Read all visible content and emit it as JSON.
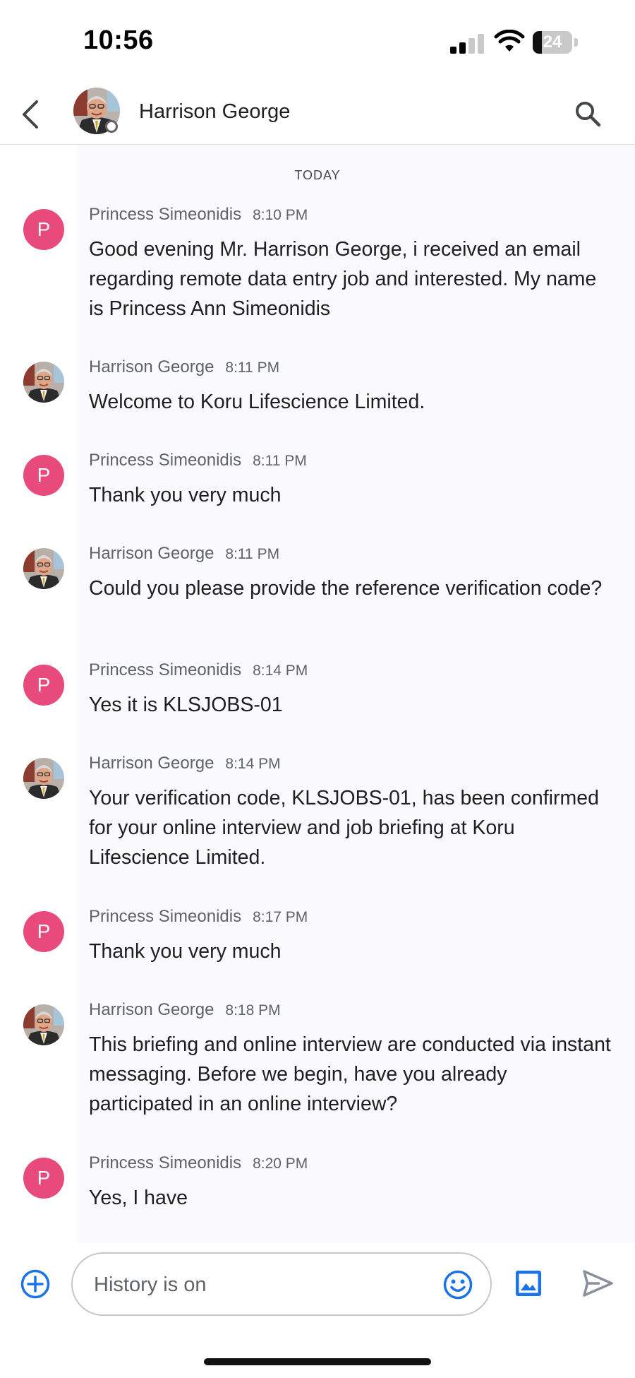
{
  "status_bar": {
    "time": "10:56",
    "battery": "24",
    "battery_level": 0.24,
    "signal_bars": 2
  },
  "header": {
    "title": "Harrison George",
    "back_icon": "chevron-left-icon",
    "search_icon": "search-icon",
    "avatar": "harrison-george-photo"
  },
  "chat": {
    "date_separator": "TODAY",
    "messages": [
      {
        "sender": "Princess Simeonidis",
        "time": "8:10 PM",
        "avatar_letter": "P",
        "text": "Good evening Mr. Harrison George, i received an email regarding remote data entry job and interested. My name is Princess Ann Simeonidis"
      },
      {
        "sender": "Harrison George",
        "time": "8:11 PM",
        "avatar_letter": "",
        "text": "Welcome to Koru Lifescience Limited."
      },
      {
        "sender": "Princess Simeonidis",
        "time": "8:11 PM",
        "avatar_letter": "P",
        "text": "Thank you very much"
      },
      {
        "sender": "Harrison George",
        "time": "8:11 PM",
        "avatar_letter": "",
        "text": "Could you please provide the reference verification code?"
      },
      {
        "sender": "Princess Simeonidis",
        "time": "8:14 PM",
        "avatar_letter": "P",
        "text": "Yes it is KLSJOBS-01"
      },
      {
        "sender": "Harrison George",
        "time": "8:14 PM",
        "avatar_letter": "",
        "text": "Your verification code, KLSJOBS-01, has been confirmed for your online interview and job briefing at Koru Lifescience Limited."
      },
      {
        "sender": "Princess Simeonidis",
        "time": "8:17 PM",
        "avatar_letter": "P",
        "text": "Thank you very much"
      },
      {
        "sender": "Harrison George",
        "time": "8:18 PM",
        "avatar_letter": "",
        "text": "This briefing and online interview are conducted via instant messaging. Before we begin, have you already participated in an online interview?"
      },
      {
        "sender": "Princess Simeonidis",
        "time": "8:20 PM",
        "avatar_letter": "P",
        "text": "Yes, I have"
      }
    ]
  },
  "composer": {
    "placeholder": "History is on",
    "add_icon": "add-circle-icon",
    "emoji_icon": "emoji-icon",
    "image_icon": "image-icon",
    "send_icon": "send-icon"
  },
  "colors": {
    "avatar_pink": "#e84a7c",
    "accent_blue": "#1a73e8",
    "send_gray": "#8a9099"
  }
}
